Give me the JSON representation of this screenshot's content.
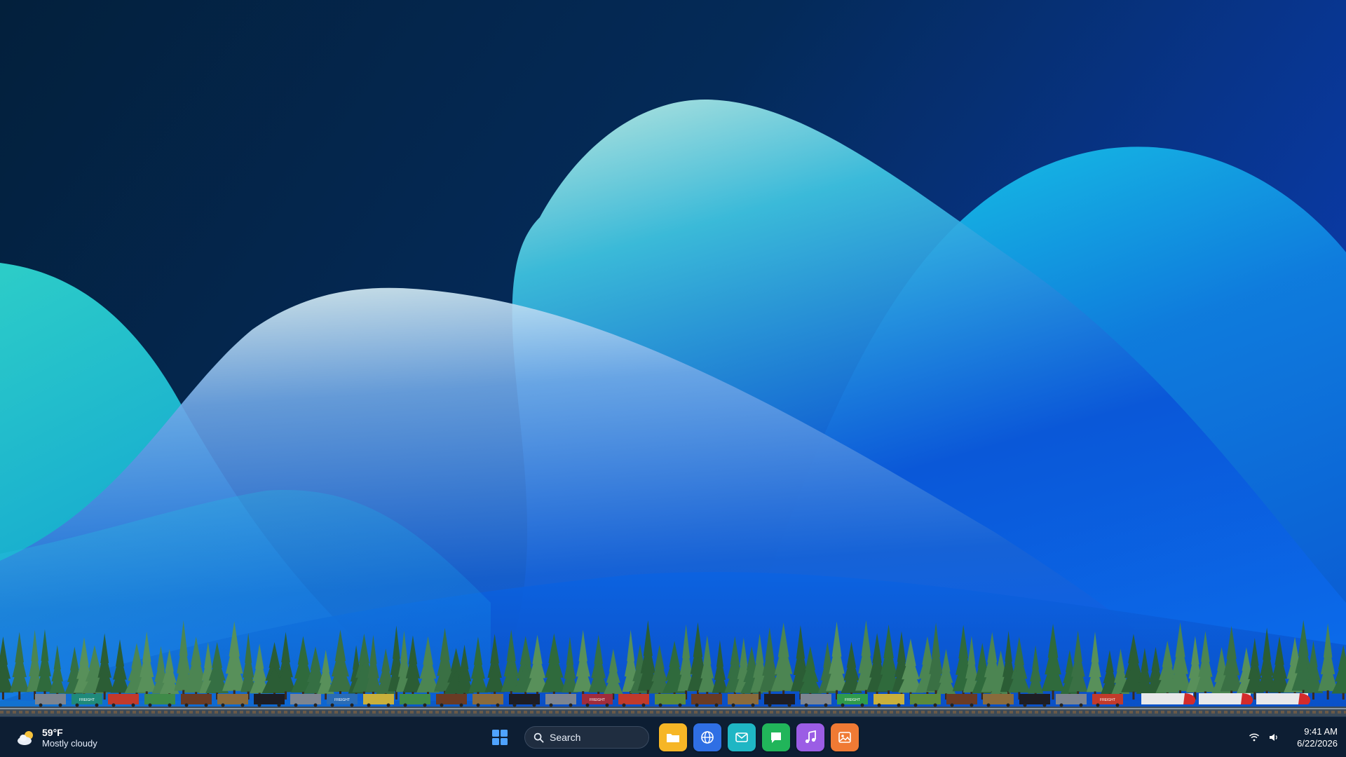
{
  "wallpaper": {
    "colors": {
      "sky_top": "#03213f",
      "sky_right": "#0a3da8",
      "wave_cyan": "#2ad4d9",
      "wave_blue": "#0a68e8",
      "pine_dark": "#2a5a34",
      "pine_light": "#4f8a55"
    },
    "train": {
      "car_label": "FREIGHT"
    }
  },
  "taskbar": {
    "weather": {
      "icon": "partly-cloudy-icon",
      "temperature": "59°F",
      "condition": "Mostly cloudy"
    },
    "start": {
      "icon": "windows-start-icon"
    },
    "search": {
      "label": "Search",
      "icon": "search-icon"
    },
    "apps": [
      {
        "name": "file-explorer",
        "icon": "folder-icon",
        "color": "#f6b626"
      },
      {
        "name": "browser",
        "icon": "globe-icon",
        "color": "#2f6fe4"
      },
      {
        "name": "mail",
        "icon": "mail-icon",
        "color": "#1fb6c4"
      },
      {
        "name": "messages",
        "icon": "chat-icon",
        "color": "#21b55a"
      },
      {
        "name": "music",
        "icon": "music-icon",
        "color": "#9b5de5"
      },
      {
        "name": "photos",
        "icon": "photo-icon",
        "color": "#f07a34"
      }
    ],
    "tray": {
      "wifi_icon": "wifi-icon",
      "volume_icon": "volume-icon"
    },
    "clock": {
      "time": "9:41 AM",
      "date": "6/22/2026"
    }
  }
}
